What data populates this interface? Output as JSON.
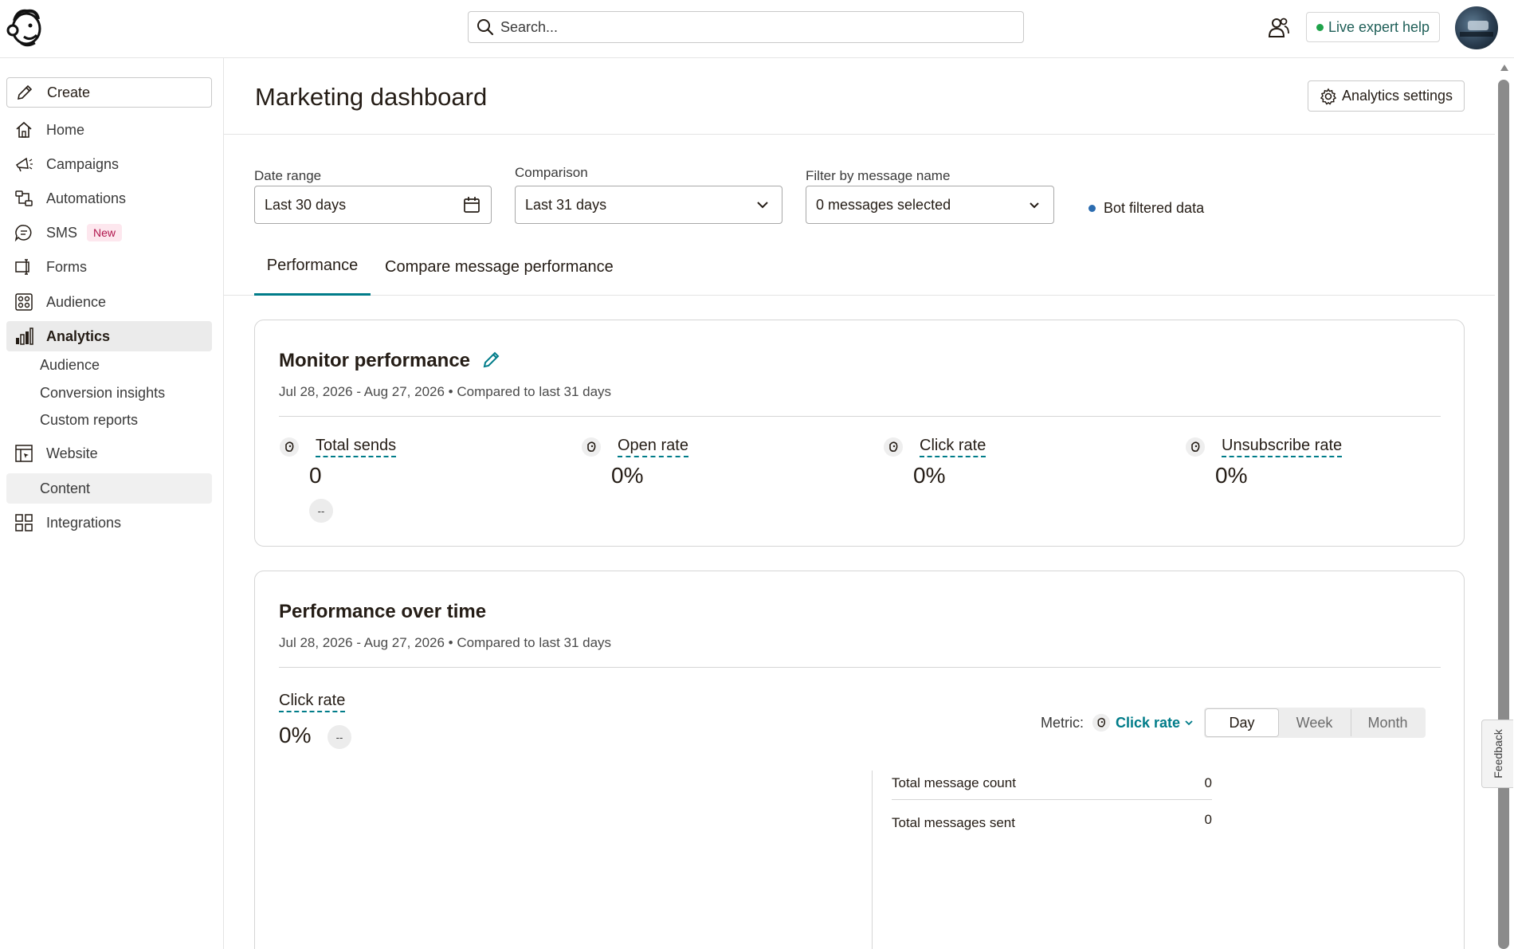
{
  "topbar": {
    "search_placeholder": "Search...",
    "live_help_label": "Live expert help",
    "icons": [
      "mailchimp-logo-icon",
      "search-icon",
      "account-switch-icon",
      "avatar"
    ]
  },
  "sidebar": {
    "create_label": "Create",
    "items": {
      "home": "Home",
      "campaigns": "Campaigns",
      "automations": "Automations",
      "sms": "SMS",
      "sms_badge": "New",
      "forms": "Forms",
      "audience": "Audience",
      "analytics": "Analytics",
      "analytics_audience": "Audience",
      "conversion_insights": "Conversion insights",
      "custom_reports": "Custom reports",
      "website": "Website",
      "content": "Content",
      "integrations": "Integrations"
    }
  },
  "page": {
    "title": "Marketing dashboard",
    "settings_label": "Analytics settings"
  },
  "filters": {
    "date_range_label": "Date range",
    "date_range_value": "Last 30 days",
    "comparison_label": "Comparison",
    "comparison_value": "Last 31 days",
    "message_filter_label": "Filter by message name",
    "message_filter_value": "0 messages selected",
    "bot_filtered_label": "Bot filtered data"
  },
  "tabs": {
    "performance": "Performance",
    "compare": "Compare message performance"
  },
  "monitor": {
    "title": "Monitor performance",
    "subtitle": "Jul 28, 2026 - Aug 27, 2026 • Compared to last 31 days",
    "metrics": [
      {
        "label": "Total sends",
        "value": "0",
        "delta": "--"
      },
      {
        "label": "Open rate",
        "value": "0%"
      },
      {
        "label": "Click rate",
        "value": "0%"
      },
      {
        "label": "Unsubscribe rate",
        "value": "0%"
      }
    ]
  },
  "over_time": {
    "title": "Performance over time",
    "subtitle": "Jul 28, 2026 - Aug 27, 2026 • Compared to last 31 days",
    "metric_label": "Click rate",
    "metric_value": "0%",
    "metric_delta": "--",
    "selector_prefix": "Metric:",
    "selector_value": "Click rate",
    "periods": [
      "Day",
      "Week",
      "Month"
    ],
    "active_period": "Day",
    "stats": [
      {
        "label": "Total message count",
        "value": "0"
      },
      {
        "label": "Total messages sent",
        "value": "0"
      }
    ]
  },
  "feedback_label": "Feedback",
  "colors": {
    "accent": "#007c89",
    "live_dot": "#1fa34a",
    "bot_dot": "#2b6cb0",
    "active_nav_bg": "#ebebeb"
  }
}
